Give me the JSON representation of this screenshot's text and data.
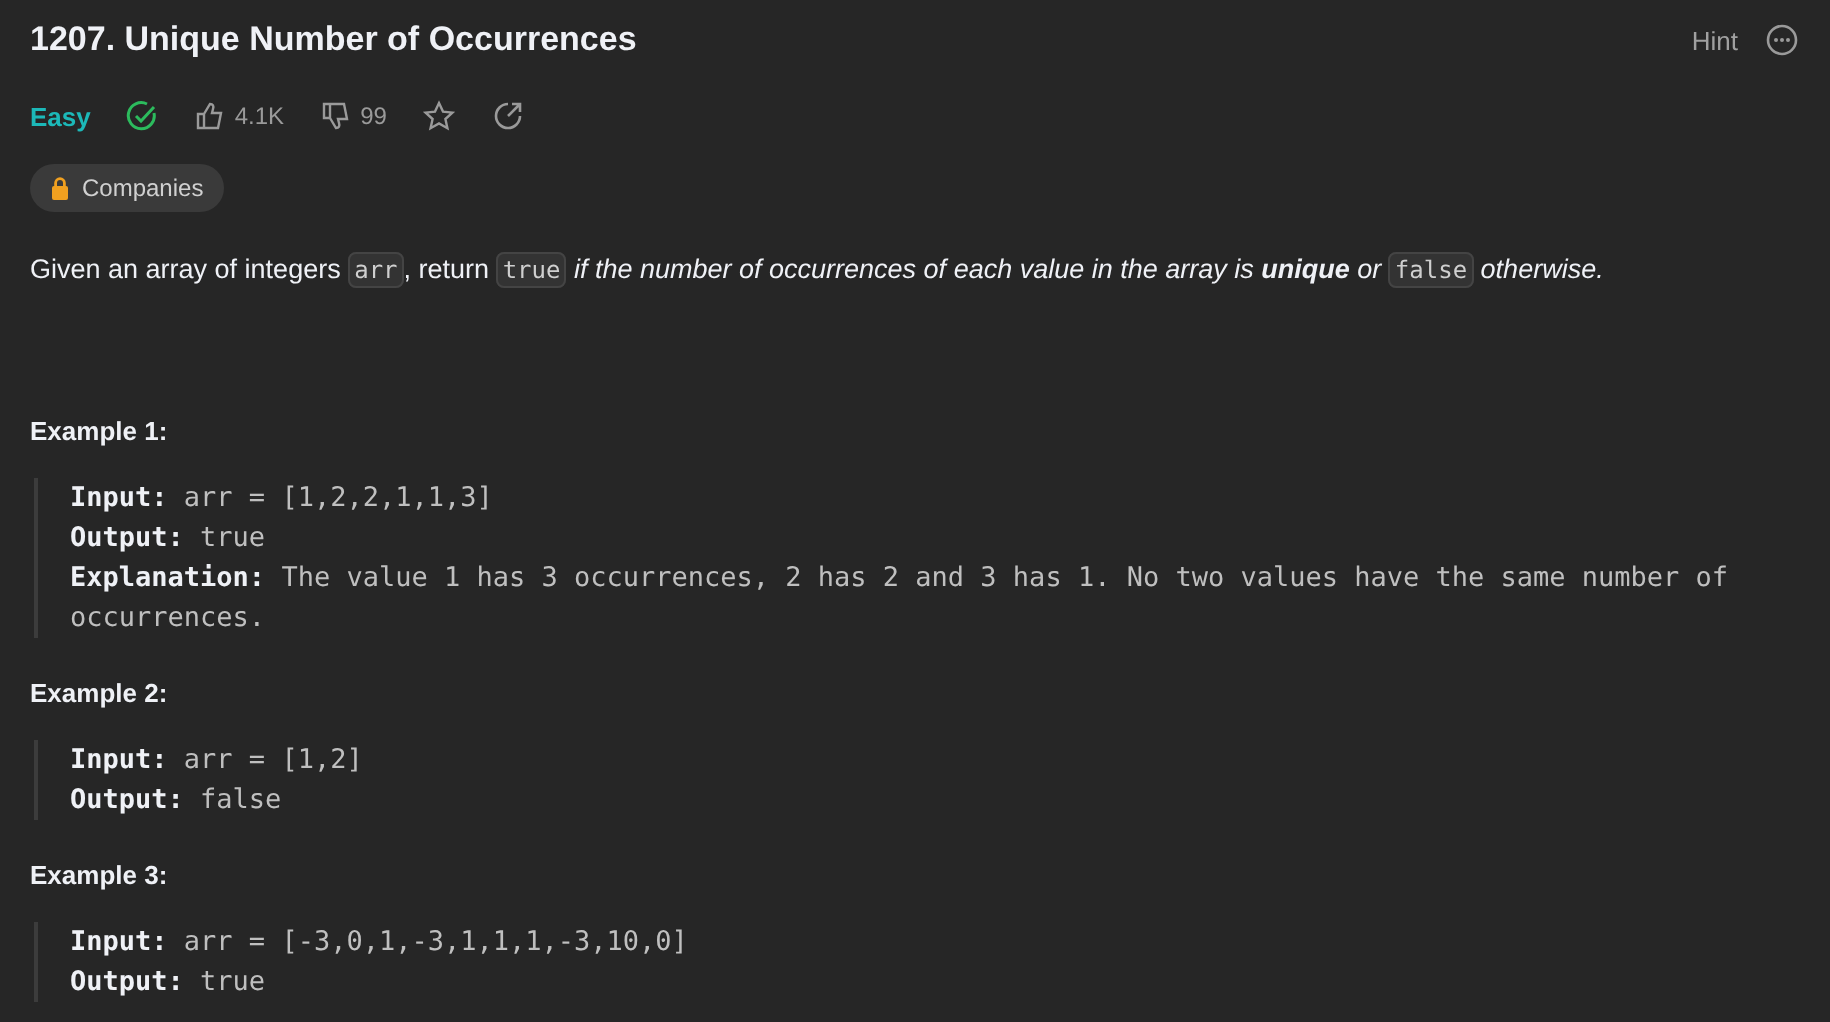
{
  "title": "1207. Unique Number of Occurrences",
  "hint": "Hint",
  "difficulty": "Easy",
  "solved": true,
  "likes": "4.1K",
  "dislikes": "99",
  "companies": "Companies",
  "description": [
    {
      "kind": "text",
      "text": "Given an array of integers "
    },
    {
      "kind": "code",
      "text": "arr"
    },
    {
      "kind": "text",
      "text": ", return "
    },
    {
      "kind": "code",
      "text": "true"
    },
    {
      "kind": "italic",
      "text": " if the number of occurrences of each value in the array is **unique** or "
    },
    {
      "kind": "code",
      "text": "false"
    },
    {
      "kind": "italic",
      "text": " otherwise."
    }
  ],
  "examples": [
    {
      "title": "Example 1:",
      "lines": [
        {
          "label": "Input:",
          "value": "arr = [1,2,2,1,1,3]"
        },
        {
          "label": "Output:",
          "value": "true"
        },
        {
          "label": "Explanation:",
          "value": "The value 1 has 3 occurrences, 2 has 2 and 3 has 1. No two values have the same number of occurrences."
        }
      ]
    },
    {
      "title": "Example 2:",
      "lines": [
        {
          "label": "Input:",
          "value": "arr = [1,2]"
        },
        {
          "label": "Output:",
          "value": "false"
        }
      ]
    },
    {
      "title": "Example 3:",
      "lines": [
        {
          "label": "Input:",
          "value": "arr = [-3,0,1,-3,1,1,1,-3,10,0]"
        },
        {
          "label": "Output:",
          "value": "true"
        }
      ]
    }
  ]
}
